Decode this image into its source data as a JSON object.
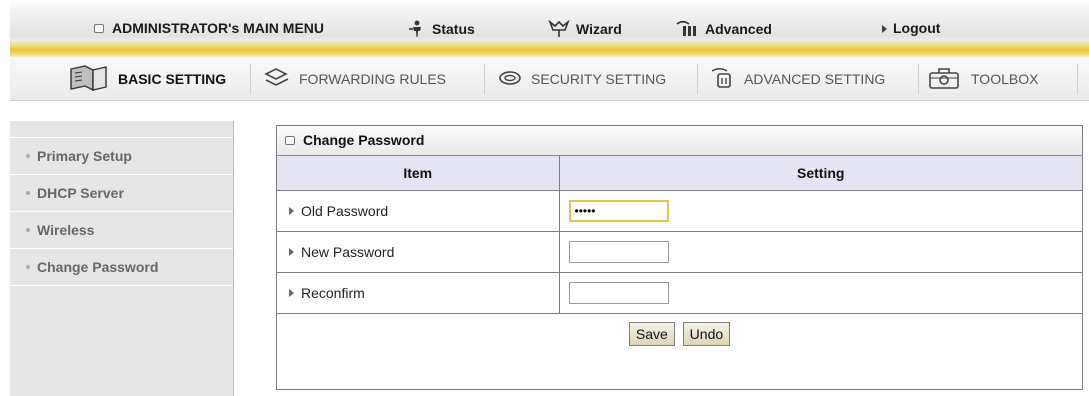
{
  "top_menu": {
    "items": [
      {
        "label": "ADMINISTRATOR's MAIN MENU",
        "icon": "square-icon"
      },
      {
        "label": "Status",
        "icon": "person-icon"
      },
      {
        "label": "Wizard",
        "icon": "wizard-icon"
      },
      {
        "label": "Advanced",
        "icon": "advanced-icon"
      },
      {
        "label": "Logout",
        "icon": "arrow-right-icon"
      }
    ]
  },
  "tabs": [
    {
      "label": "BASIC SETTING",
      "icon": "book-icon",
      "active": true
    },
    {
      "label": "FORWARDING RULES",
      "icon": "forwarding-icon",
      "active": false
    },
    {
      "label": "SECURITY SETTING",
      "icon": "security-icon",
      "active": false
    },
    {
      "label": "ADVANCED SETTING",
      "icon": "advanced-setting-icon",
      "active": false
    },
    {
      "label": "TOOLBOX",
      "icon": "toolbox-icon",
      "active": false
    }
  ],
  "sidebar": {
    "items": [
      {
        "label": "Primary Setup"
      },
      {
        "label": "DHCP Server"
      },
      {
        "label": "Wireless"
      },
      {
        "label": "Change Password"
      }
    ]
  },
  "panel": {
    "title": "Change Password",
    "col_item": "Item",
    "col_setting": "Setting",
    "rows": [
      {
        "label": "Old Password",
        "value": "•••••"
      },
      {
        "label": "New Password",
        "value": ""
      },
      {
        "label": "Reconfirm",
        "value": ""
      }
    ],
    "save_label": "Save",
    "undo_label": "Undo"
  },
  "colors": {
    "header_bg": "#e4e4f3",
    "sidebar_bg": "#e6e6e6",
    "accent_yellow": "#e9c63a"
  }
}
